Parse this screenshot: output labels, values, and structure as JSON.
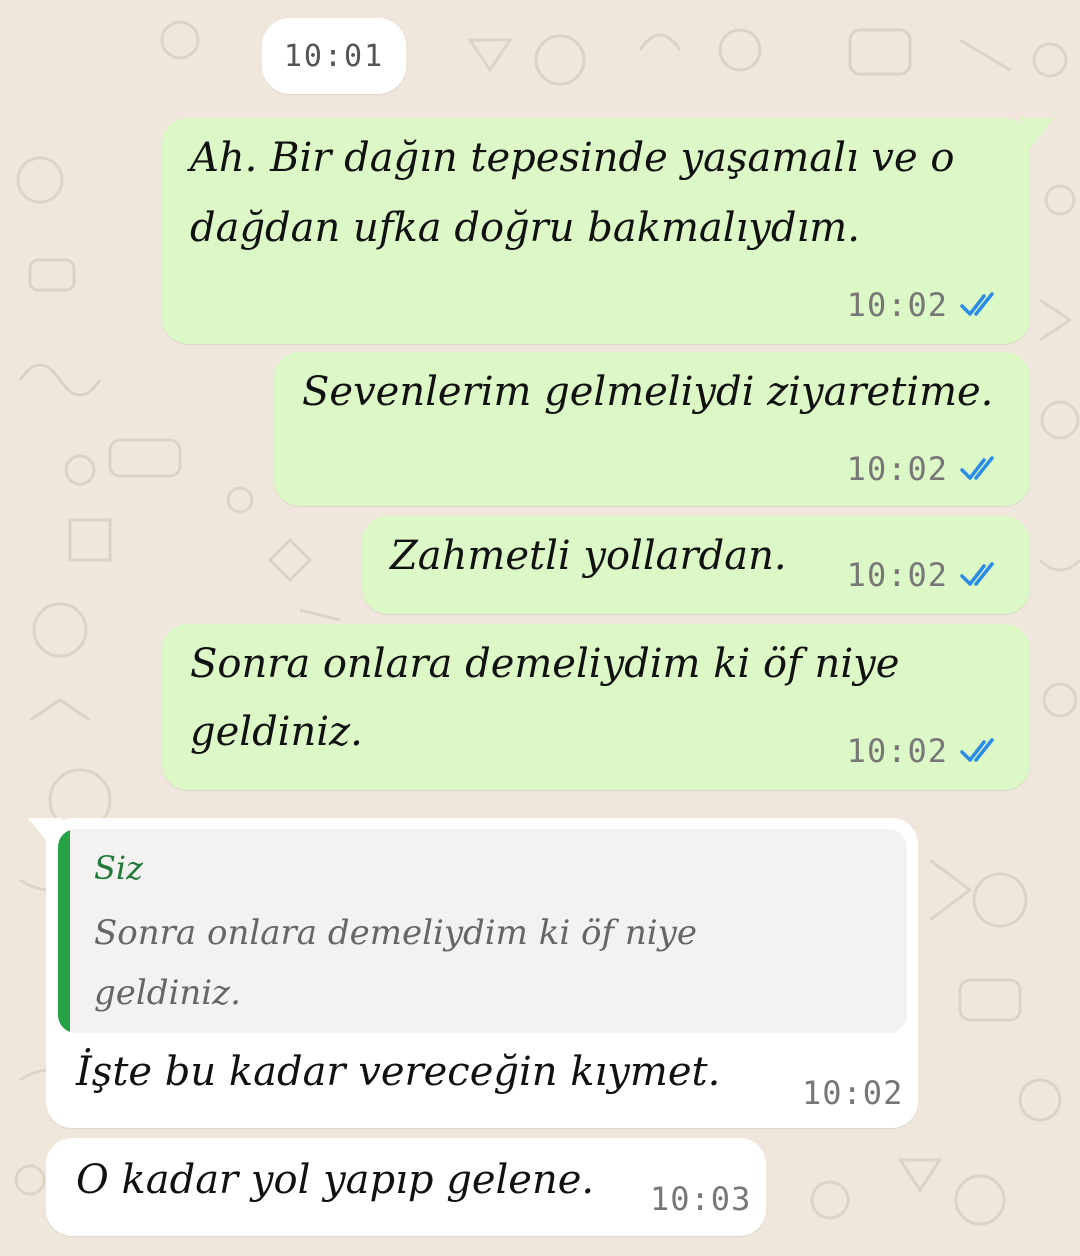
{
  "date_chip": "10:01",
  "colors": {
    "outgoing_bubble": "#dcf8c6",
    "incoming_bubble": "#ffffff",
    "read_ticks": "#2b8ce8",
    "quote_bar": "#25a244",
    "background": "#efe7dc"
  },
  "messages": [
    {
      "direction": "outgoing",
      "text_lines": [
        "Ah. Bir dağın tepesinde yaşamalı ve o",
        "dağdan ufka doğru bakmalıydım."
      ],
      "time": "10:02",
      "status_icon": "double-check-read-icon"
    },
    {
      "direction": "outgoing",
      "text_lines": [
        "Sevenlerim gelmeliydi ziyaretime."
      ],
      "time": "10:02",
      "status_icon": "double-check-read-icon"
    },
    {
      "direction": "outgoing",
      "text_lines": [
        "Zahmetli yollardan."
      ],
      "time": "10:02",
      "status_icon": "double-check-read-icon"
    },
    {
      "direction": "outgoing",
      "text_lines": [
        "Sonra onlara demeliydim ki öf niye",
        "geldiniz."
      ],
      "time": "10:02",
      "status_icon": "double-check-read-icon"
    },
    {
      "direction": "incoming",
      "reply_to": {
        "author": "Siz",
        "text_lines": [
          "Sonra onlara demeliydim ki öf niye",
          "geldiniz."
        ]
      },
      "text_lines": [
        "İşte bu kadar vereceğin kıymet."
      ],
      "time": "10:02"
    },
    {
      "direction": "incoming",
      "text_lines": [
        "O kadar yol yapıp gelene."
      ],
      "time": "10:03"
    }
  ]
}
